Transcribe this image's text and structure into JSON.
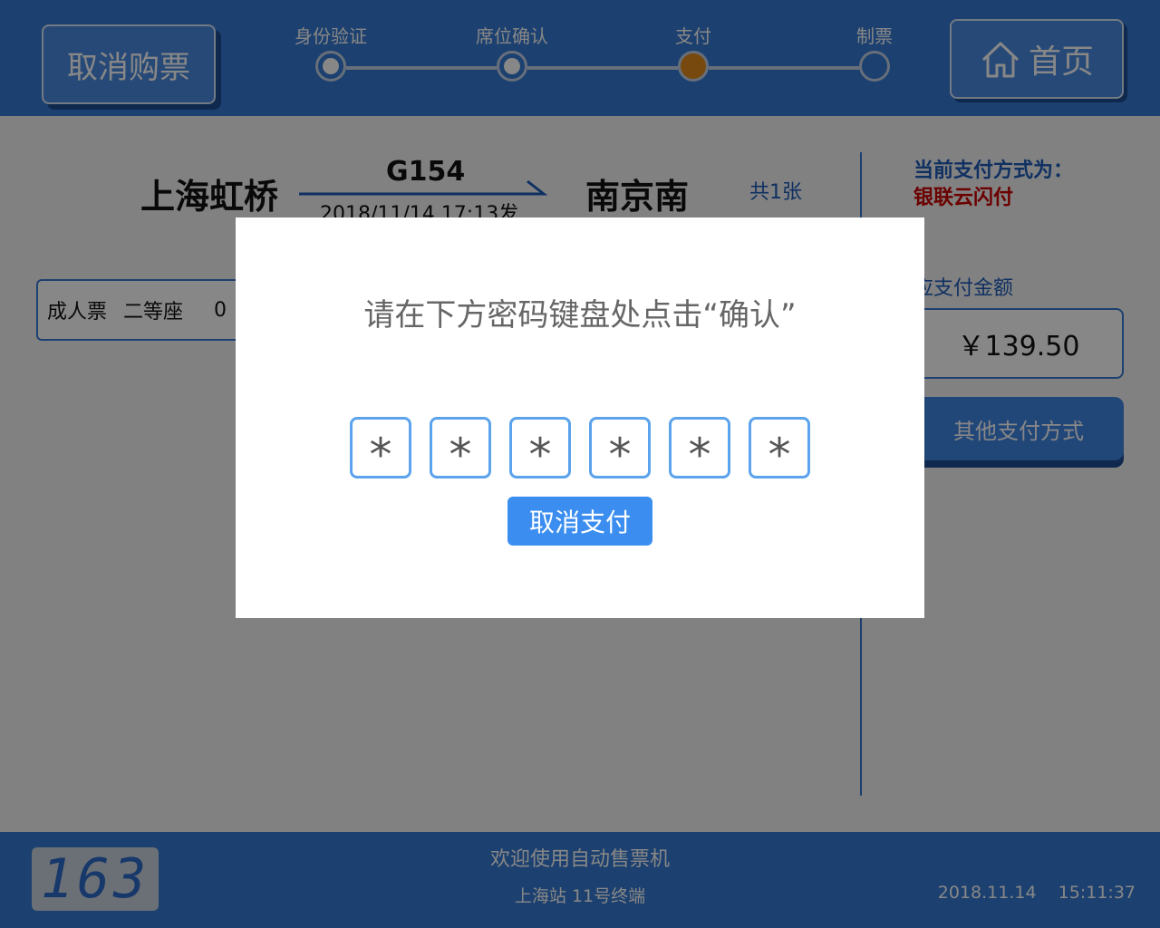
{
  "header": {
    "cancel_buy_label": "取消购票",
    "home_label": "首页",
    "steps": [
      {
        "label": "身份验证",
        "state": "done"
      },
      {
        "label": "席位确认",
        "state": "done"
      },
      {
        "label": "支付",
        "state": "current"
      },
      {
        "label": "制票",
        "state": "pending"
      }
    ]
  },
  "trip": {
    "from": "上海虹桥",
    "to": "南京南",
    "train": "G154",
    "depart": "2018/11/14 17:13发",
    "count": "共1张"
  },
  "ticket": {
    "type": "成人票",
    "seat_class": "二等座",
    "extra": "0"
  },
  "payment": {
    "method_label": "当前支付方式为：",
    "method_value": "银联云闪付",
    "amount_label": "应支付金额",
    "amount": "￥139.50",
    "other_label": "其他支付方式"
  },
  "modal": {
    "message": "请在下方密码键盘处点击“确认”",
    "pin_chars": [
      "*",
      "*",
      "*",
      "*",
      "*",
      "*"
    ],
    "cancel_label": "取消支付"
  },
  "footer": {
    "counter": "163",
    "welcome": "欢迎使用自动售票机",
    "station": "上海站 11号终端",
    "date": "2018.11.14",
    "time": "15:11:37"
  },
  "colors": {
    "primary": "#3579d1",
    "accent_current_step": "#e08a1e",
    "method_red": "#cc0000",
    "modal_button": "#3b8ef0"
  }
}
